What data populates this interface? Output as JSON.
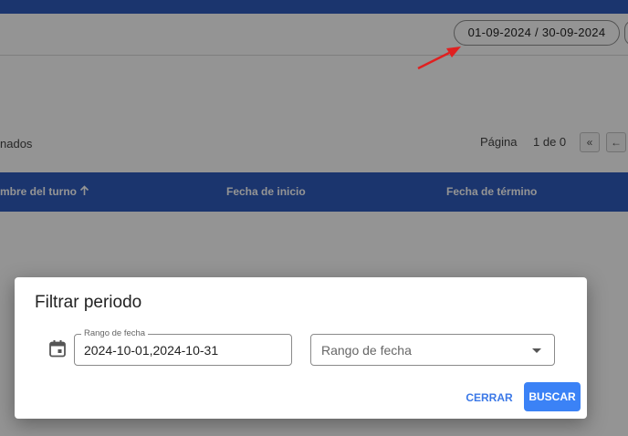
{
  "toolbar": {
    "date_range_chip": "01-09-2024 / 30-09-2024"
  },
  "results": {
    "selected_text": "nados"
  },
  "pagination": {
    "label": "Página",
    "count": "1 de 0",
    "first_icon": "«",
    "prev_icon": "←"
  },
  "table": {
    "columns": [
      {
        "label": "mbre del turno",
        "sort": "arrow-up-icon"
      },
      {
        "label": "Fecha de inicio"
      },
      {
        "label": "Fecha de término"
      }
    ]
  },
  "dialog": {
    "title": "Filtrar periodo",
    "date_field": {
      "label": "Rango de fecha",
      "value": "2024-10-01,2024-10-31"
    },
    "select": {
      "placeholder": "Rango de fecha"
    },
    "buttons": {
      "close": "CERRAR",
      "search": "BUSCAR"
    }
  },
  "colors": {
    "brand_blue": "#2f5cbd",
    "primary_button": "#3b82f6",
    "link_blue": "#3b78e7",
    "annotation_arrow": "#e02020"
  }
}
